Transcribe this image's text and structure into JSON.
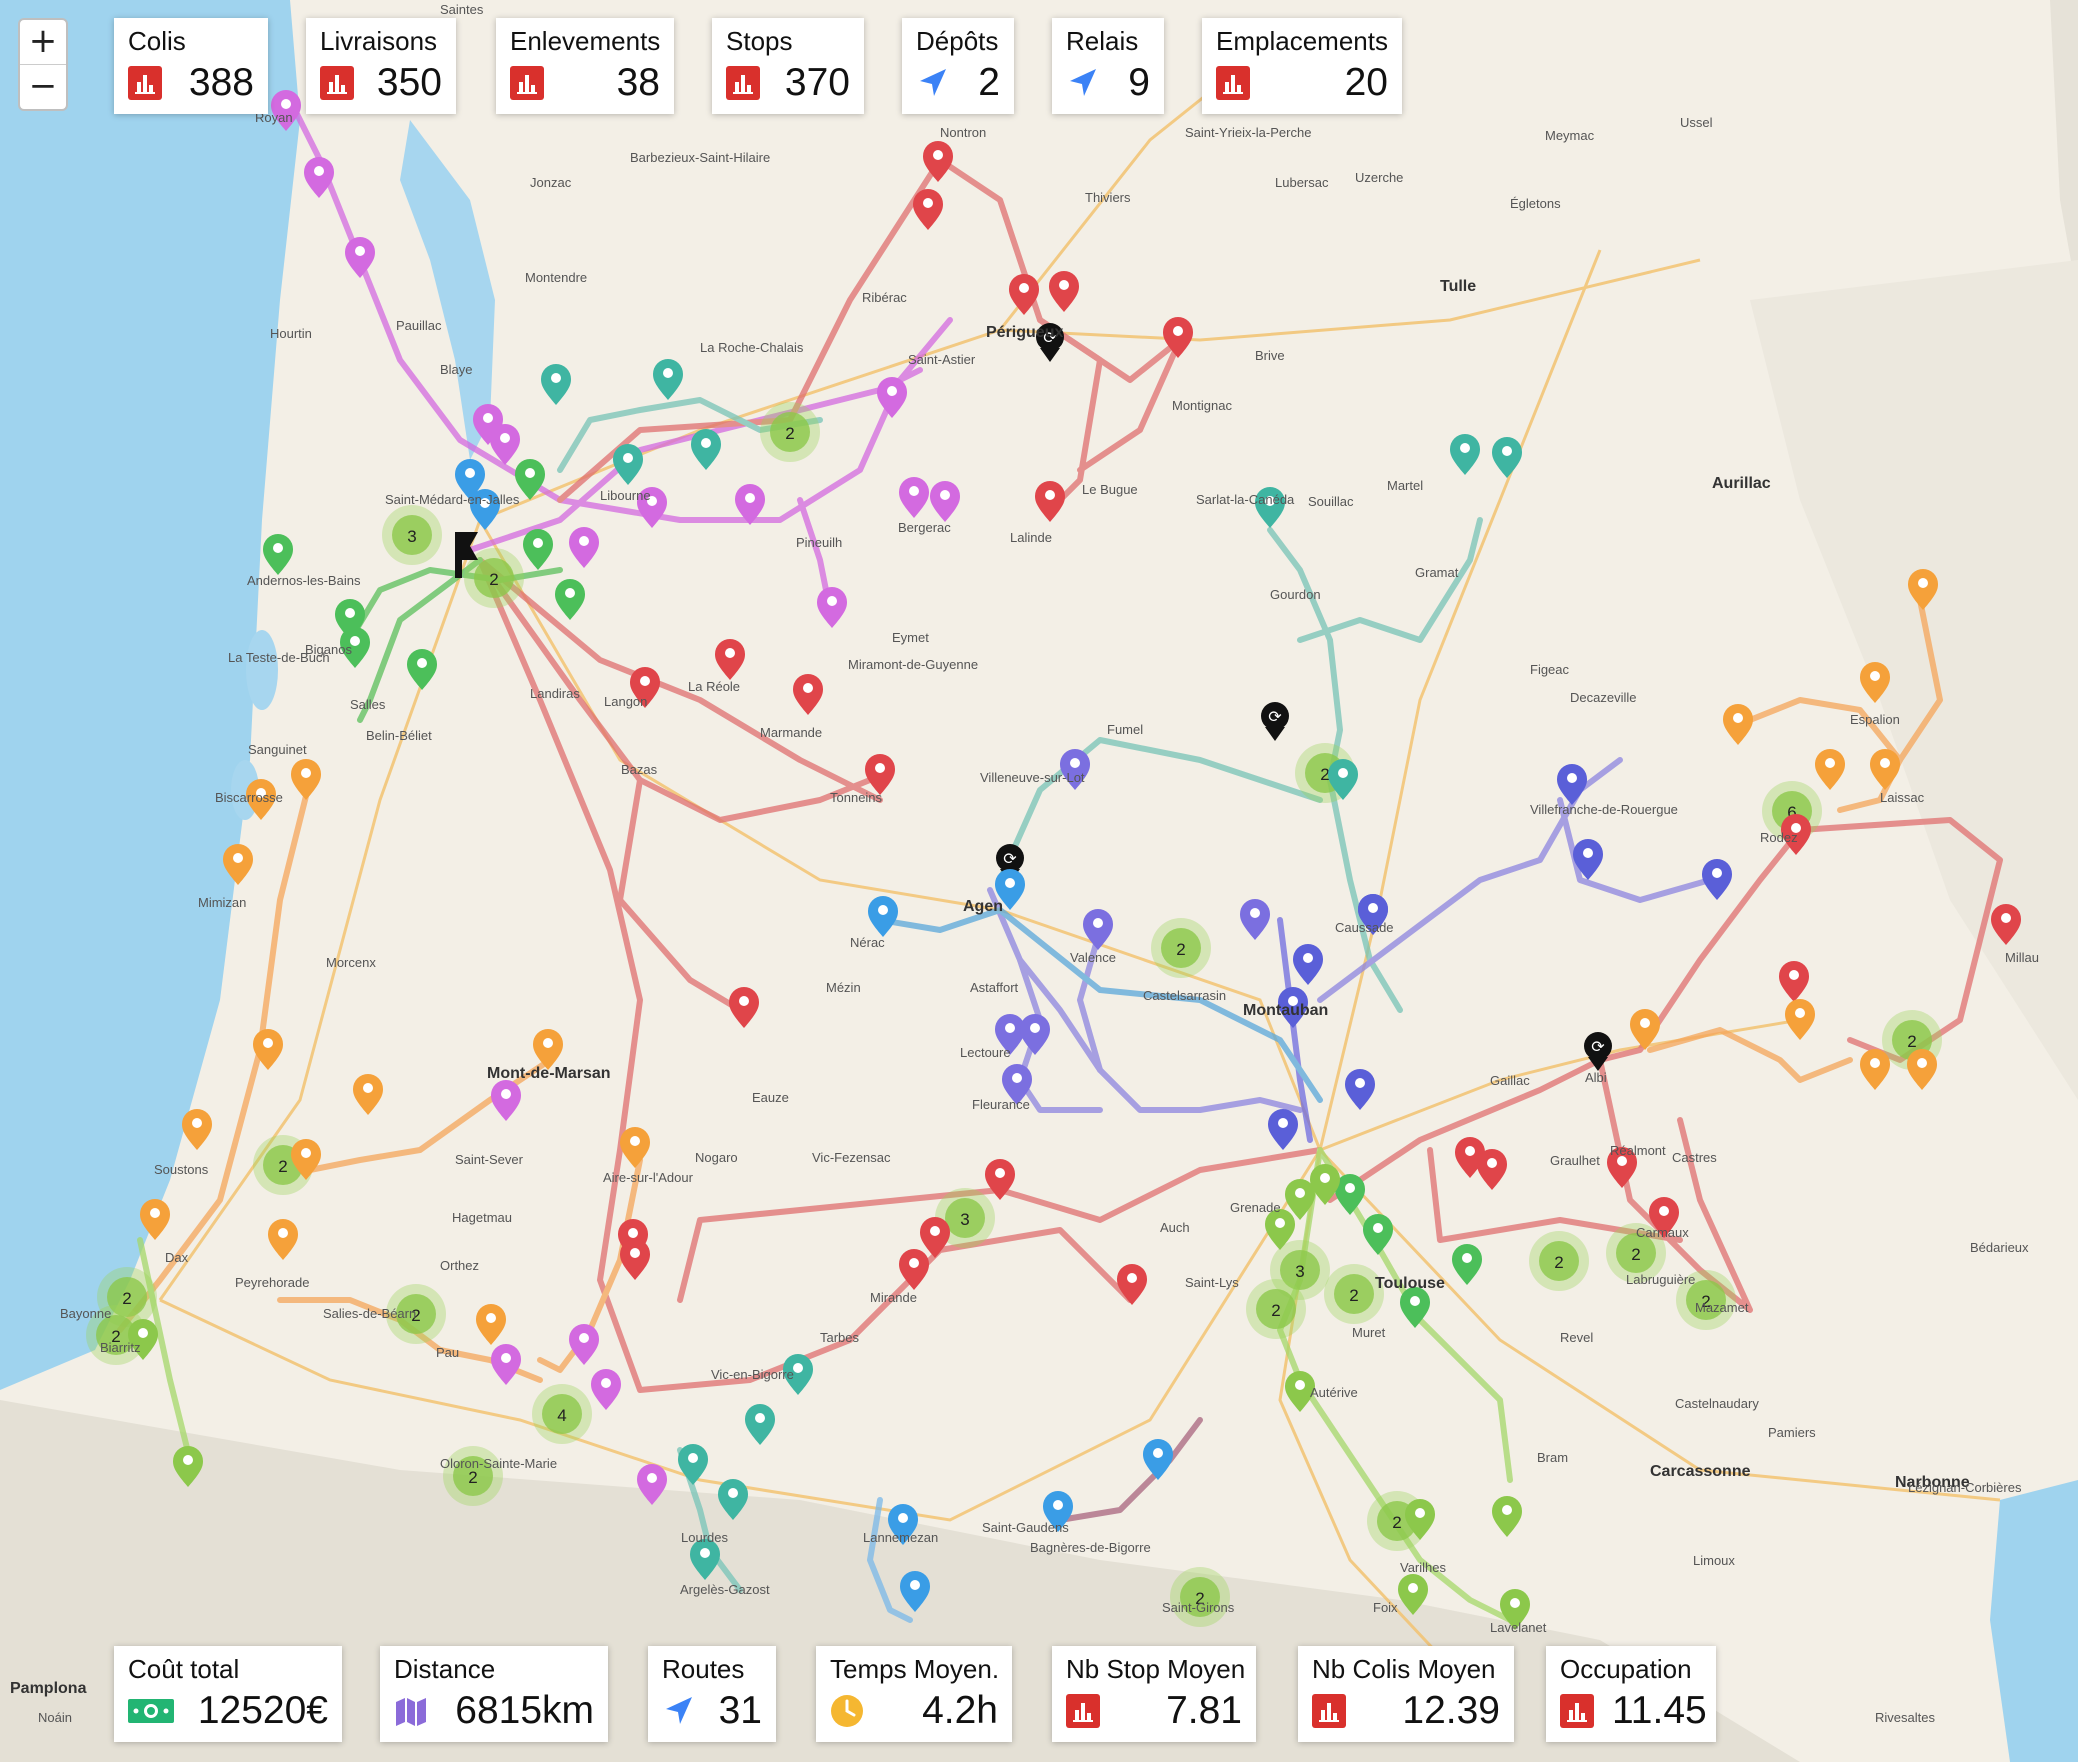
{
  "zoom": {
    "in_label": "+",
    "out_label": "−"
  },
  "top_stats": [
    {
      "label": "Colis",
      "value": "388",
      "icon": "bar-chart-icon",
      "color": "#d9302c"
    },
    {
      "label": "Livraisons",
      "value": "350",
      "icon": "bar-chart-icon",
      "color": "#d9302c"
    },
    {
      "label": "Enlevements",
      "value": "38",
      "icon": "bar-chart-icon",
      "color": "#d9302c"
    },
    {
      "label": "Stops",
      "value": "370",
      "icon": "bar-chart-icon",
      "color": "#d9302c"
    },
    {
      "label": "Dépôts",
      "value": "2",
      "icon": "location-arrow-icon",
      "color": "#3b82f6"
    },
    {
      "label": "Relais",
      "value": "9",
      "icon": "location-arrow-icon",
      "color": "#3b82f6"
    },
    {
      "label": "Emplacements",
      "value": "20",
      "icon": "bar-chart-icon",
      "color": "#d9302c"
    }
  ],
  "bottom_stats": [
    {
      "label": "Coût total",
      "value": "12520€",
      "icon": "money-icon",
      "color": "#22b573"
    },
    {
      "label": "Distance",
      "value": "6815km",
      "icon": "map-icon",
      "color": "#8b6bd9"
    },
    {
      "label": "Routes",
      "value": "31",
      "icon": "location-arrow-icon",
      "color": "#3b82f6"
    },
    {
      "label": "Temps Moyen.",
      "value": "4.2h",
      "icon": "clock-icon",
      "color": "#f5b731"
    },
    {
      "label": "Nb Stop Moyen",
      "value": "7.81",
      "icon": "bar-chart-icon",
      "color": "#d9302c"
    },
    {
      "label": "Nb Colis Moyen",
      "value": "12.39",
      "icon": "bar-chart-icon",
      "color": "#d9302c"
    },
    {
      "label": "Occupation",
      "value": "11.45",
      "icon": "bar-chart-icon",
      "color": "#d9302c"
    }
  ],
  "towns": [
    {
      "name": "Saintes"
    },
    {
      "name": "Royan"
    },
    {
      "name": "Jonzac"
    },
    {
      "name": "Barbezieux-Saint-Hilaire"
    },
    {
      "name": "Nontron"
    },
    {
      "name": "Saint-Yrieix-la-Perche"
    },
    {
      "name": "Lubersac"
    },
    {
      "name": "Thiviers"
    },
    {
      "name": "Uzerche"
    },
    {
      "name": "Tulle"
    },
    {
      "name": "Ussel"
    },
    {
      "name": "Meymac"
    },
    {
      "name": "Égletons"
    },
    {
      "name": "Montendre"
    },
    {
      "name": "Pauillac"
    },
    {
      "name": "Blaye"
    },
    {
      "name": "Ribérac"
    },
    {
      "name": "La Roche-Chalais"
    },
    {
      "name": "Saint-Astier"
    },
    {
      "name": "Périgueux"
    },
    {
      "name": "Montignac"
    },
    {
      "name": "Brive"
    },
    {
      "name": "Aurillac"
    },
    {
      "name": "Hourtin"
    },
    {
      "name": "Saint-Médard-en-Jalles"
    },
    {
      "name": "Libourne"
    },
    {
      "name": "Bergerac"
    },
    {
      "name": "Pineuilh"
    },
    {
      "name": "Lalinde"
    },
    {
      "name": "Le Bugue"
    },
    {
      "name": "Sarlat-la-Canéda"
    },
    {
      "name": "Souillac"
    },
    {
      "name": "Martel"
    },
    {
      "name": "Gramat"
    },
    {
      "name": "Gourdon"
    },
    {
      "name": "Figeac"
    },
    {
      "name": "Decazeville"
    },
    {
      "name": "Andernos-les-Bains"
    },
    {
      "name": "La Teste-de-Buch"
    },
    {
      "name": "Biganos"
    },
    {
      "name": "Salles"
    },
    {
      "name": "Belin-Béliet"
    },
    {
      "name": "Landiras"
    },
    {
      "name": "Langon"
    },
    {
      "name": "La Réole"
    },
    {
      "name": "Marmande"
    },
    {
      "name": "Eymet"
    },
    {
      "name": "Miramont-de-Guyenne"
    },
    {
      "name": "Fumel"
    },
    {
      "name": "Villeneuve-sur-Lot"
    },
    {
      "name": "Tonneins"
    },
    {
      "name": "Bazas"
    },
    {
      "name": "Sanguinet"
    },
    {
      "name": "Biscarrosse"
    },
    {
      "name": "Mimizan"
    },
    {
      "name": "Agen"
    },
    {
      "name": "Nérac"
    },
    {
      "name": "Valence"
    },
    {
      "name": "Castelsarrasin"
    },
    {
      "name": "Montauban"
    },
    {
      "name": "Caussade"
    },
    {
      "name": "Villefranche-de-Rouergue"
    },
    {
      "name": "Rodez"
    },
    {
      "name": "Millau"
    },
    {
      "name": "Mont-de-Marsan"
    },
    {
      "name": "Morcenx"
    },
    {
      "name": "Lectoure"
    },
    {
      "name": "Fleurance"
    },
    {
      "name": "Astaffort"
    },
    {
      "name": "Mézin"
    },
    {
      "name": "Eauze"
    },
    {
      "name": "Nogaro"
    },
    {
      "name": "Vic-Fezensac"
    },
    {
      "name": "Aire-sur-l'Adour"
    },
    {
      "name": "Saint-Sever"
    },
    {
      "name": "Hagetmau"
    },
    {
      "name": "Dax"
    },
    {
      "name": "Soustons"
    },
    {
      "name": "Peyrehorade"
    },
    {
      "name": "Orthez"
    },
    {
      "name": "Salies-de-Béarn"
    },
    {
      "name": "Pau"
    },
    {
      "name": "Oloron-Sainte-Marie"
    },
    {
      "name": "Tarbes"
    },
    {
      "name": "Lourdes"
    },
    {
      "name": "Bagnères-de-Bigorre"
    },
    {
      "name": "Lannemezan"
    },
    {
      "name": "Saint-Gaudens"
    },
    {
      "name": "Mirande"
    },
    {
      "name": "Auch"
    },
    {
      "name": "Toulouse"
    },
    {
      "name": "Muret"
    },
    {
      "name": "Saint-Lys"
    },
    {
      "name": "Grenade"
    },
    {
      "name": "Gaillac"
    },
    {
      "name": "Albi"
    },
    {
      "name": "Carmaux"
    },
    {
      "name": "Castres"
    },
    {
      "name": "Mazamet"
    },
    {
      "name": "Revel"
    },
    {
      "name": "Castelnaudary"
    },
    {
      "name": "Carcassonne"
    },
    {
      "name": "Pamiers"
    },
    {
      "name": "Foix"
    },
    {
      "name": "Limoux"
    },
    {
      "name": "Lavelanet"
    },
    {
      "name": "Narbonne"
    },
    {
      "name": "Bayonne"
    },
    {
      "name": "Biarritz"
    },
    {
      "name": "Pamplona"
    },
    {
      "name": "Noáin"
    },
    {
      "name": "Argelès-Gazost"
    },
    {
      "name": "Saint-Girons"
    },
    {
      "name": "Varilhes"
    },
    {
      "name": "Autérive"
    },
    {
      "name": "Graulhet"
    },
    {
      "name": "Labruguière"
    },
    {
      "name": "Espalion"
    },
    {
      "name": "Laissac"
    },
    {
      "name": "Réalmont"
    },
    {
      "name": "Bram"
    },
    {
      "name": "Lézignan-Corbières"
    },
    {
      "name": "Rivesaltes"
    },
    {
      "name": "Bédarieux"
    },
    {
      "name": "Vic-en-Bigorre"
    }
  ]
}
